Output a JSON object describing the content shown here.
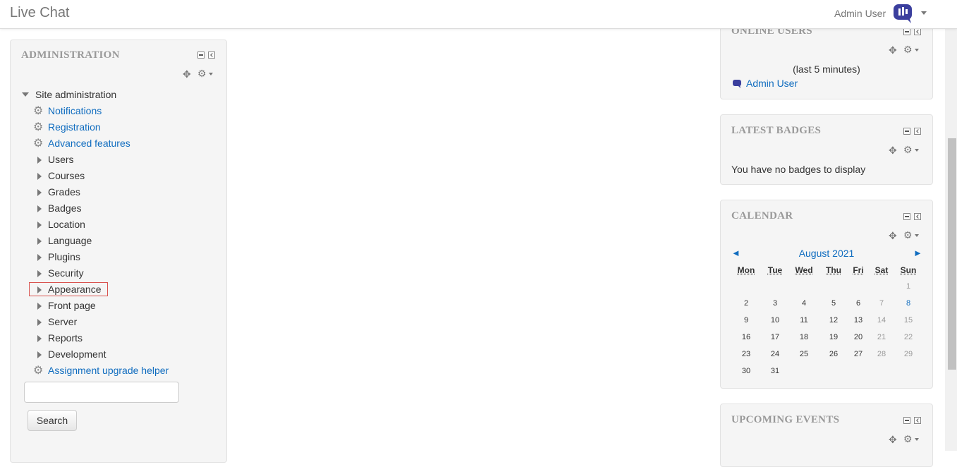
{
  "navbar": {
    "brand": "Live Chat",
    "user_name": "Admin User"
  },
  "admin_block": {
    "title": "ADMINISTRATION",
    "root": "Site administration",
    "items": [
      {
        "label": "Notifications",
        "type": "link"
      },
      {
        "label": "Registration",
        "type": "link"
      },
      {
        "label": "Advanced features",
        "type": "link"
      },
      {
        "label": "Users",
        "type": "category"
      },
      {
        "label": "Courses",
        "type": "category"
      },
      {
        "label": "Grades",
        "type": "category"
      },
      {
        "label": "Badges",
        "type": "category"
      },
      {
        "label": "Location",
        "type": "category"
      },
      {
        "label": "Language",
        "type": "category"
      },
      {
        "label": "Plugins",
        "type": "category"
      },
      {
        "label": "Security",
        "type": "category"
      },
      {
        "label": "Appearance",
        "type": "category"
      },
      {
        "label": "Front page",
        "type": "category"
      },
      {
        "label": "Server",
        "type": "category"
      },
      {
        "label": "Reports",
        "type": "category"
      },
      {
        "label": "Development",
        "type": "category"
      },
      {
        "label": "Assignment upgrade helper",
        "type": "link"
      }
    ],
    "search_value": "",
    "search_button": "Search"
  },
  "online_users": {
    "title": "ONLINE USERS",
    "period": "(last 5 minutes)",
    "user": "Admin User"
  },
  "latest_badges": {
    "title": "LATEST BADGES",
    "message": "You have no badges to display"
  },
  "calendar": {
    "title": "CALENDAR",
    "month": "August 2021",
    "prev": "◄",
    "next": "►",
    "days": [
      "Mon",
      "Tue",
      "Wed",
      "Thu",
      "Fri",
      "Sat",
      "Sun"
    ],
    "weeks": [
      [
        "",
        "",
        "",
        "",
        "",
        "",
        "1"
      ],
      [
        "2",
        "3",
        "4",
        "5",
        "6",
        "7",
        "8"
      ],
      [
        "9",
        "10",
        "11",
        "12",
        "13",
        "14",
        "15"
      ],
      [
        "16",
        "17",
        "18",
        "19",
        "20",
        "21",
        "22"
      ],
      [
        "23",
        "24",
        "25",
        "26",
        "27",
        "28",
        "29"
      ],
      [
        "30",
        "31",
        "",
        "",
        "",
        "",
        ""
      ]
    ],
    "today": "8"
  },
  "upcoming_events": {
    "title": "UPCOMING EVENTS"
  },
  "icons": {
    "gear": "⚙",
    "move": "✥"
  },
  "colors": {
    "link": "#0f6cbf",
    "highlight": "#d9534f",
    "avatar": "#3b3f9e"
  }
}
